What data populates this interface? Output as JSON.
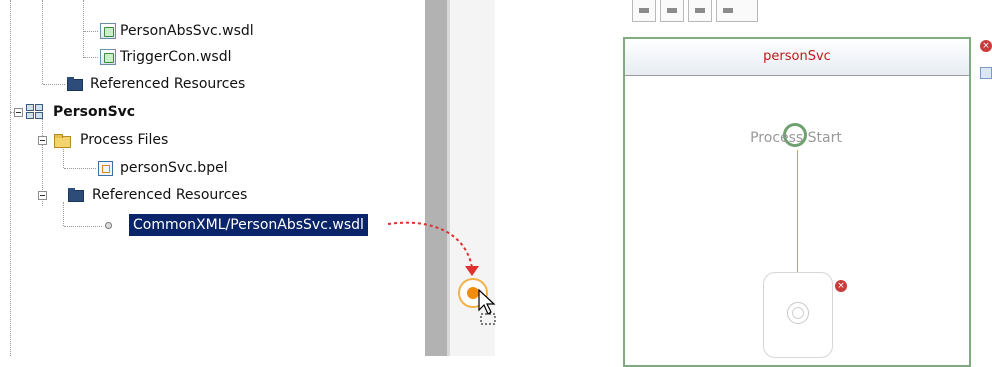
{
  "tree": {
    "items": [
      {
        "label": "PersonAbsSvc.wsdl",
        "icon": "wsdl-icon"
      },
      {
        "label": "TriggerCon.wsdl",
        "icon": "wsdl-icon"
      },
      {
        "label": "Referenced Resources",
        "icon": "folder-icon"
      },
      {
        "label": "PersonSvc",
        "icon": "project-icon"
      },
      {
        "label": "Process Files",
        "icon": "folder-open-icon"
      },
      {
        "label": "personSvc.bpel",
        "icon": "bpel-file-icon"
      },
      {
        "label": "Referenced Resources",
        "icon": "folder-icon"
      },
      {
        "label": "CommonXML/PersonAbsSvc.wsdl",
        "icon": "reference-icon",
        "selected": true
      }
    ]
  },
  "canvas": {
    "process_title": "personSvc",
    "start_label": "Process Start"
  },
  "colors": {
    "selection": "#0a246a",
    "process_title": "#c01818",
    "drag_arrow": "#e03030",
    "drop_target": "#f28c0c",
    "process_border": "#7eac7e"
  }
}
